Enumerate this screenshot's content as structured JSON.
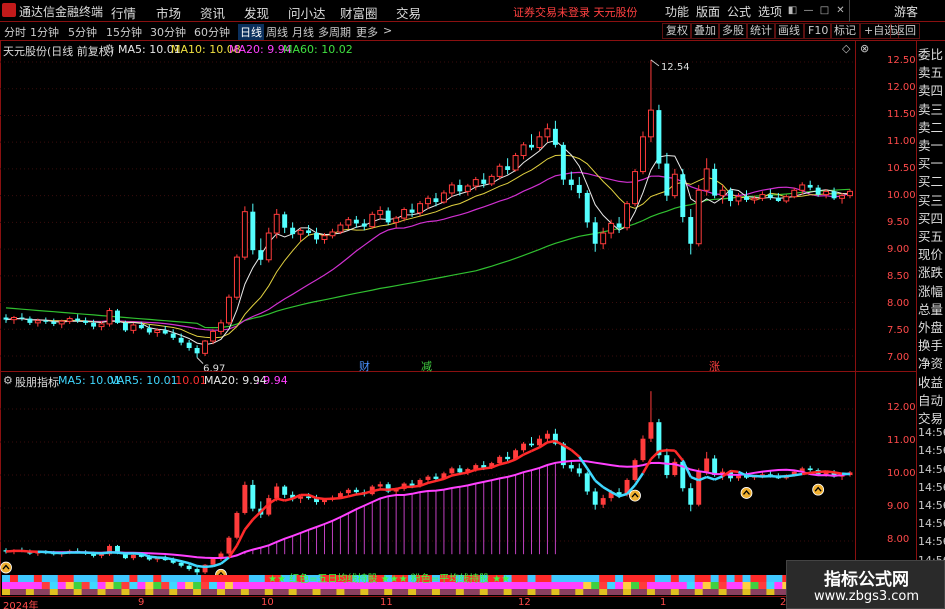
{
  "app": {
    "title": "通达信金融终端",
    "alert": "证券交易未登录  天元股份"
  },
  "menu": [
    "行情",
    "市场",
    "资讯",
    "发现",
    "问小达",
    "财富圈",
    "交易"
  ],
  "right_menu": [
    "功能",
    "版面",
    "公式",
    "选项"
  ],
  "user": "游客",
  "periods": [
    "分时",
    "1分钟",
    "5分钟",
    "15分钟",
    "30分钟",
    "60分钟",
    "日线",
    "周线",
    "月线",
    "多周期",
    "更多"
  ],
  "active_period": "日线",
  "tools": [
    "复权",
    "叠加",
    "多股",
    "统计",
    "画线",
    "F10",
    "标记",
    "+自选",
    "返回"
  ],
  "main": {
    "stock_title": "天元股份(日线 前复权)",
    "ma": [
      {
        "label": "MA5: 10.01",
        "color": "#e8e8e8"
      },
      {
        "label": "MA10: 10.08",
        "color": "#f0e040"
      },
      {
        "label": "MA20: 9.94",
        "color": "#ff40ff"
      },
      {
        "label": "MA60: 10.02",
        "color": "#40e040"
      }
    ],
    "y_labels": [
      "12.50",
      "12.00",
      "11.50",
      "11.00",
      "10.50",
      "10.00",
      "9.50",
      "9.00",
      "8.50",
      "8.00",
      "7.50",
      "7.00"
    ],
    "high_label": "12.54",
    "low_label": "6.97",
    "event_markers": [
      {
        "text": "财",
        "color": "#4a90ff"
      },
      {
        "text": "减",
        "color": "#40d040"
      },
      {
        "text": "涨",
        "color": "#ff4040"
      }
    ]
  },
  "indicator": {
    "title": "股朋指标",
    "values": [
      {
        "label": "MA5: 10.01",
        "color": "#40d8ff"
      },
      {
        "label": "VAR5: 10.01",
        "color": "#40d8ff"
      },
      {
        "label": ": 10.01",
        "color": "#ff3030"
      },
      {
        "label": "MA20: 9.94",
        "color": "#e8e8e8"
      },
      {
        "label": ": 9.94",
        "color": "#ff40ff"
      }
    ],
    "y_labels": [
      "12.00",
      "11.00",
      "10.00",
      "9.00",
      "8.00"
    ],
    "caption": "★★ 红色=五日均线持股 ★★★ 粉色=平均线持股 ★★"
  },
  "x_axis": [
    "2024年",
    "9",
    "10",
    "11",
    "12",
    "1",
    "2"
  ],
  "right_panel": [
    "委比",
    "卖五",
    "卖四",
    "卖三",
    "卖二",
    "卖一",
    "买一",
    "买二",
    "买三",
    "买四",
    "买五",
    "现价",
    "涨跌",
    "涨幅",
    "总量",
    "外盘",
    "换手",
    "净资",
    "收益",
    "自动",
    "交易",
    "14:56",
    "14:56",
    "14:56",
    "14:56",
    "14:56",
    "14:56",
    "14:56",
    "14:56",
    "14:56",
    "14:56"
  ],
  "watermark": {
    "name": "指标公式网",
    "url": "www.zbgs3.com"
  },
  "chart_data": {
    "type": "candlestick",
    "price_range": [
      6.75,
      12.8
    ],
    "candles": [
      [
        7.72,
        7.78,
        7.62,
        7.68
      ],
      [
        7.68,
        7.75,
        7.6,
        7.72
      ],
      [
        7.72,
        7.8,
        7.66,
        7.7
      ],
      [
        7.7,
        7.74,
        7.58,
        7.62
      ],
      [
        7.62,
        7.7,
        7.55,
        7.66
      ],
      [
        7.66,
        7.72,
        7.6,
        7.64
      ],
      [
        7.64,
        7.7,
        7.56,
        7.6
      ],
      [
        7.6,
        7.68,
        7.52,
        7.65
      ],
      [
        7.65,
        7.74,
        7.6,
        7.7
      ],
      [
        7.7,
        7.78,
        7.62,
        7.66
      ],
      [
        7.66,
        7.72,
        7.58,
        7.62
      ],
      [
        7.62,
        7.68,
        7.5,
        7.55
      ],
      [
        7.55,
        7.65,
        7.48,
        7.6
      ],
      [
        7.6,
        7.9,
        7.55,
        7.85
      ],
      [
        7.85,
        7.88,
        7.6,
        7.62
      ],
      [
        7.62,
        7.66,
        7.45,
        7.48
      ],
      [
        7.48,
        7.62,
        7.42,
        7.58
      ],
      [
        7.58,
        7.64,
        7.5,
        7.52
      ],
      [
        7.52,
        7.58,
        7.4,
        7.44
      ],
      [
        7.44,
        7.52,
        7.36,
        7.48
      ],
      [
        7.48,
        7.56,
        7.4,
        7.42
      ],
      [
        7.42,
        7.5,
        7.3,
        7.34
      ],
      [
        7.34,
        7.42,
        7.2,
        7.25
      ],
      [
        7.25,
        7.3,
        7.1,
        7.15
      ],
      [
        7.15,
        7.2,
        6.97,
        7.05
      ],
      [
        7.05,
        7.3,
        7.0,
        7.28
      ],
      [
        7.28,
        7.5,
        7.22,
        7.46
      ],
      [
        7.46,
        7.68,
        7.4,
        7.62
      ],
      [
        7.62,
        8.15,
        7.58,
        8.1
      ],
      [
        8.1,
        8.9,
        8.05,
        8.85
      ],
      [
        8.85,
        9.8,
        8.8,
        9.7
      ],
      [
        9.7,
        9.85,
        8.9,
        8.98
      ],
      [
        8.98,
        9.2,
        8.7,
        8.8
      ],
      [
        8.8,
        9.4,
        8.75,
        9.3
      ],
      [
        9.3,
        9.75,
        9.2,
        9.65
      ],
      [
        9.65,
        9.7,
        9.3,
        9.4
      ],
      [
        9.4,
        9.5,
        9.2,
        9.28
      ],
      [
        9.28,
        9.4,
        9.15,
        9.35
      ],
      [
        9.35,
        9.45,
        9.25,
        9.3
      ],
      [
        9.3,
        9.4,
        9.1,
        9.18
      ],
      [
        9.18,
        9.3,
        9.1,
        9.25
      ],
      [
        9.25,
        9.38,
        9.2,
        9.32
      ],
      [
        9.32,
        9.5,
        9.28,
        9.45
      ],
      [
        9.45,
        9.6,
        9.38,
        9.55
      ],
      [
        9.55,
        9.62,
        9.4,
        9.48
      ],
      [
        9.48,
        9.56,
        9.35,
        9.42
      ],
      [
        9.42,
        9.7,
        9.38,
        9.65
      ],
      [
        9.65,
        9.8,
        9.55,
        9.72
      ],
      [
        9.72,
        9.78,
        9.45,
        9.5
      ],
      [
        9.5,
        9.62,
        9.4,
        9.58
      ],
      [
        9.58,
        9.78,
        9.52,
        9.74
      ],
      [
        9.74,
        9.85,
        9.6,
        9.68
      ],
      [
        9.68,
        9.9,
        9.62,
        9.85
      ],
      [
        9.85,
        10.0,
        9.75,
        9.95
      ],
      [
        9.95,
        10.05,
        9.8,
        9.88
      ],
      [
        9.88,
        10.1,
        9.85,
        10.05
      ],
      [
        10.05,
        10.25,
        9.98,
        10.2
      ],
      [
        10.2,
        10.3,
        10.0,
        10.08
      ],
      [
        10.08,
        10.22,
        10.0,
        10.18
      ],
      [
        10.18,
        10.35,
        10.1,
        10.3
      ],
      [
        10.3,
        10.42,
        10.15,
        10.22
      ],
      [
        10.22,
        10.4,
        10.18,
        10.36
      ],
      [
        10.36,
        10.6,
        10.3,
        10.55
      ],
      [
        10.55,
        10.7,
        10.4,
        10.48
      ],
      [
        10.48,
        10.8,
        10.45,
        10.75
      ],
      [
        10.75,
        11.0,
        10.68,
        10.95
      ],
      [
        10.95,
        11.15,
        10.85,
        10.9
      ],
      [
        10.9,
        11.2,
        10.85,
        11.1
      ],
      [
        11.1,
        11.35,
        11.0,
        11.25
      ],
      [
        11.25,
        11.4,
        10.9,
        10.95
      ],
      [
        10.95,
        11.0,
        10.2,
        10.3
      ],
      [
        10.3,
        10.45,
        10.1,
        10.2
      ],
      [
        10.2,
        10.35,
        9.95,
        10.05
      ],
      [
        10.05,
        10.1,
        9.4,
        9.5
      ],
      [
        9.5,
        9.6,
        8.95,
        9.1
      ],
      [
        9.1,
        9.4,
        9.0,
        9.3
      ],
      [
        9.3,
        9.55,
        9.2,
        9.48
      ],
      [
        9.48,
        9.6,
        9.3,
        9.4
      ],
      [
        9.4,
        9.9,
        9.35,
        9.85
      ],
      [
        9.85,
        10.5,
        9.8,
        10.45
      ],
      [
        10.45,
        11.2,
        10.4,
        11.1
      ],
      [
        11.1,
        12.54,
        11.0,
        11.6
      ],
      [
        11.6,
        11.7,
        10.5,
        10.6
      ],
      [
        10.6,
        10.8,
        9.9,
        10.0
      ],
      [
        10.0,
        10.5,
        9.95,
        10.4
      ],
      [
        10.4,
        10.5,
        9.5,
        9.6
      ],
      [
        9.6,
        9.75,
        8.9,
        9.1
      ],
      [
        9.1,
        10.2,
        9.05,
        10.1
      ],
      [
        10.1,
        10.7,
        10.0,
        10.5
      ],
      [
        10.5,
        10.6,
        9.95,
        10.0
      ],
      [
        10.0,
        10.2,
        9.85,
        10.1
      ],
      [
        10.1,
        10.15,
        9.8,
        9.9
      ],
      [
        9.9,
        10.05,
        9.82,
        9.98
      ],
      [
        9.98,
        10.1,
        9.88,
        9.92
      ],
      [
        9.92,
        10.0,
        9.85,
        9.95
      ],
      [
        9.95,
        10.08,
        9.9,
        10.02
      ],
      [
        10.02,
        10.12,
        9.92,
        9.96
      ],
      [
        9.96,
        10.05,
        9.88,
        9.9
      ],
      [
        9.9,
        10.02,
        9.86,
        9.98
      ],
      [
        9.98,
        10.15,
        9.95,
        10.1
      ],
      [
        10.1,
        10.25,
        10.02,
        10.2
      ],
      [
        10.2,
        10.28,
        10.1,
        10.15
      ],
      [
        10.15,
        10.2,
        9.98,
        10.02
      ],
      [
        10.02,
        10.12,
        9.95,
        10.08
      ],
      [
        10.08,
        10.15,
        9.92,
        9.95
      ],
      [
        9.95,
        10.05,
        9.85,
        10.0
      ],
      [
        10.0,
        10.12,
        9.95,
        10.08
      ]
    ]
  }
}
